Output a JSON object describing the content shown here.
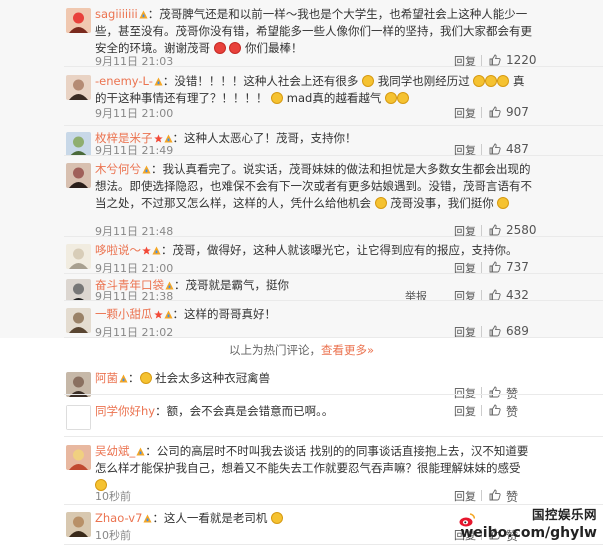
{
  "colors": {
    "username": "#eb7350",
    "link": "#eb7350",
    "text": "#333333",
    "time": "#888888"
  },
  "labels": {
    "reply": "回复",
    "like": "赞"
  },
  "hot_comments": [
    {
      "avatar": "avatar-girl-red",
      "user": "sagiiiiiii",
      "badges": [
        "vip-badge"
      ],
      "text": "：茂哥脾气还是和以前一样～我也是个大学生，也希望社会上这种人能少一些，甚至没有。茂哥你没有错，希望能多一些人像你们一样的坚持，我们大家都会有更安全的环境。谢谢茂哥 ❤ ❤ 你们最棒！",
      "time": "9月11日 21:03",
      "likes": "1220"
    },
    {
      "avatar": "avatar-woman",
      "user": "-enemy-L-",
      "badges": [
        "vip-badge"
      ],
      "text": "：没错！！！！这种人社会上还有很多 😠 我同学也刚经历过 😠😠😠 真的干这种事情还有理了？！！！！ 😠 mad真的越看越气 😠😠",
      "time": "9月11日 21:00",
      "likes": "907"
    },
    {
      "avatar": "avatar-scene",
      "user": "枚梓是米子",
      "badges": [
        "star-badge",
        "vip-badge"
      ],
      "text": "：这种人太恶心了！茂哥，支持你！",
      "time": "9月11日 21:49",
      "likes": "487"
    },
    {
      "avatar": "avatar-girl-dark",
      "user": "木兮何兮",
      "badges": [
        "vip-badge"
      ],
      "text": "：我认真看完了。说实话，茂哥妹妹的做法和担忧是大多数女生都会出现的想法。即使选择隐忍，也难保不会有下一次或者有更多姑娘遇到。没错，茂哥言语有不当之处，不过那又怎么样，这样的人，凭什么给他机会 😠 茂哥没事，我们挺你 😠",
      "time": "9月11日 21:48",
      "likes": "2580"
    },
    {
      "avatar": "avatar-light",
      "user": "哆啦说～",
      "badges": [
        "star-badge",
        "vip-badge"
      ],
      "text": "：茂哥，做得好，这种人就该曝光它，让它得到应有的报应，支持你。",
      "time": "9月11日 21:00",
      "likes": "737"
    },
    {
      "avatar": "avatar-man",
      "user": "奋斗青年口袋",
      "badges": [
        "vip-badge"
      ],
      "text": "：茂哥就是霸气，挺你",
      "time": "9月11日 21:38",
      "likes": "432",
      "extra_action": "举报"
    },
    {
      "avatar": "avatar-hair",
      "user": "一颗小甜瓜",
      "badges": [
        "star-badge",
        "vip-badge"
      ],
      "text": "：这样的哥哥真好！",
      "time": "9月11日 21:02",
      "likes": "689"
    }
  ],
  "more_comments": {
    "prefix": "以上为热门评论，",
    "link": "查看更多»"
  },
  "recent_comments": [
    {
      "avatar": "avatar-couple",
      "user": "阿菌",
      "badges": [
        "vip-badge"
      ],
      "text": "：😠 社会太多这种衣冠禽兽",
      "time": "",
      "likes": "赞"
    },
    {
      "avatar": "avatar-blank",
      "user": "同学你好hy",
      "badges": [],
      "text": "：额，会不会真是会错意而已啊。。",
      "time": "",
      "likes": "赞"
    },
    {
      "avatar": "avatar-flowers",
      "user": "吴幼斌_",
      "badges": [
        "vip-badge"
      ],
      "text": "：公司的高层时不时叫我去谈话 找别的的同事谈话直接抱上去，汉不知道要怎么样才能保护我自己，想着又不能失去工作就要忍气吞声嘛？很能理解妹妹的感受 😠",
      "time": "10秒前",
      "likes": "赞"
    },
    {
      "avatar": "avatar-man2",
      "user": "Zhao-v7",
      "badges": [
        "vip-badge"
      ],
      "text": "：这人一看就是老司机 😠",
      "time": "10秒前",
      "likes": "赞"
    }
  ],
  "watermark": {
    "line1": "国控娱乐网",
    "line2": "weibo.com/ghylw"
  }
}
